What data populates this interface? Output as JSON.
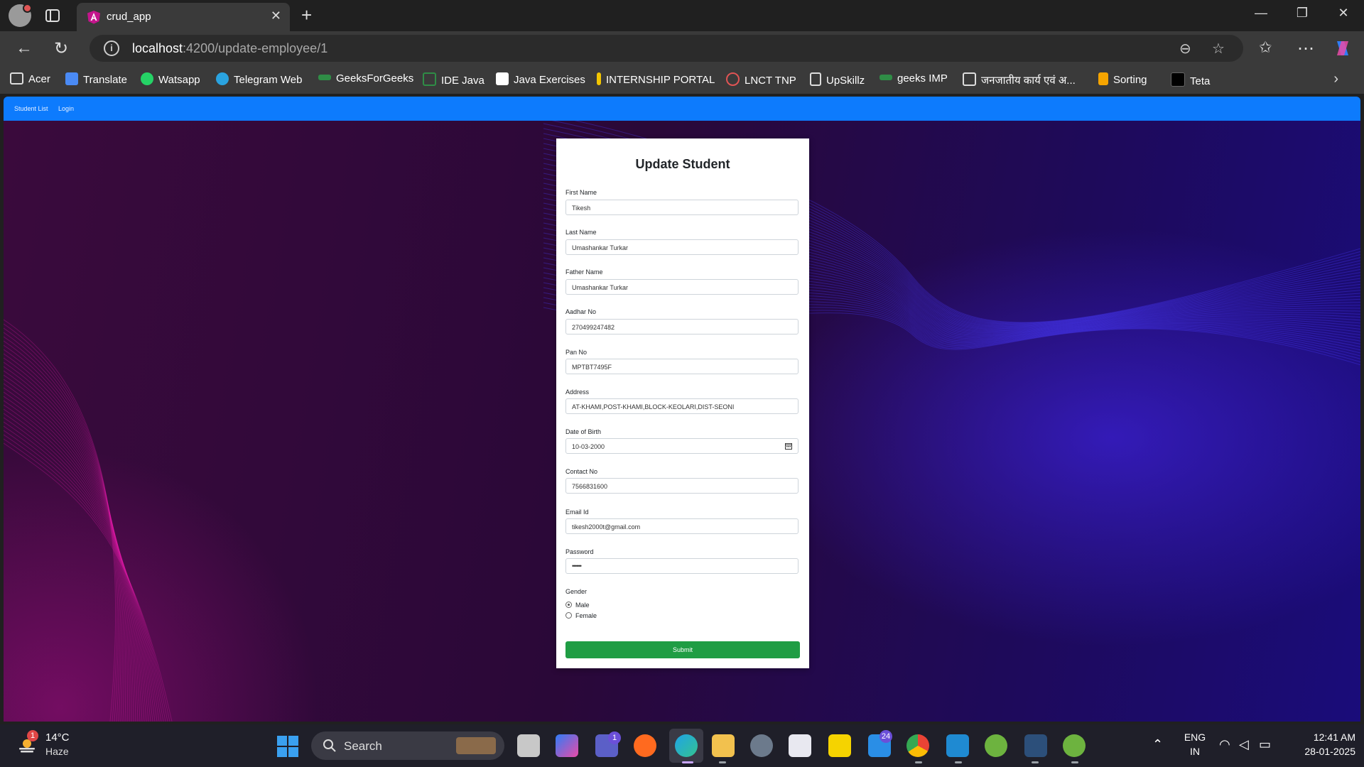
{
  "browser": {
    "tab_title": "crud_app",
    "url_host": "localhost",
    "url_path": ":4200/update-employee/1",
    "icons": [
      "profile-icon",
      "tab-actions-icon",
      "close-icon",
      "new-tab-icon",
      "minimize-icon",
      "maximize-icon",
      "close-window-icon",
      "back-icon",
      "refresh-icon",
      "info-icon",
      "zoom-icon",
      "favorite-icon",
      "favorites-icon",
      "more-icon",
      "copilot-icon"
    ]
  },
  "bookmarks": [
    "Acer",
    "Translate",
    "Watsapp",
    "Telegram Web",
    "GeeksForGeeks",
    "IDE Java",
    "Java Exercises",
    "INTERNSHIP PORTAL",
    "LNCT TNP",
    "UpSkillz",
    "geeks IMP",
    "जनजातीय कार्य एवं अ...",
    "Sorting",
    "Teta"
  ],
  "app": {
    "nav_student_list": "Student List",
    "nav_login": "Login",
    "form_title": "Update Student",
    "fields": {
      "first_name": {
        "label": "First Name",
        "value": "Tikesh"
      },
      "last_name": {
        "label": "Last Name",
        "value": "Umashankar Turkar"
      },
      "father_name": {
        "label": "Father Name",
        "value": "Umashankar Turkar"
      },
      "aadhar": {
        "label": "Aadhar No",
        "value": "270499247482"
      },
      "pan": {
        "label": "Pan No",
        "value": "MPTBT7495F"
      },
      "address": {
        "label": "Address",
        "value": "AT-KHAMI,POST-KHAMI,BLOCK-KEOLARI,DIST-SEONI"
      },
      "dob": {
        "label": "Date of Birth",
        "value": "10-03-2000"
      },
      "contact": {
        "label": "Contact No",
        "value": "7566831600"
      },
      "email": {
        "label": "Email Id",
        "value": "tikesh2000t@gmail.com"
      },
      "password": {
        "label": "Password",
        "value": "••••••"
      }
    },
    "gender_label": "Gender",
    "gender_options": [
      "Male",
      "Female"
    ],
    "gender_selected": "Male",
    "submit_label": "Submit"
  },
  "taskbar": {
    "weather_badge": "1",
    "temperature": "14°C",
    "weather": "Haze",
    "search_label": "Search",
    "teams_badge": "1",
    "mail_badge": "24",
    "lang_top": "ENG",
    "lang_bottom": "IN",
    "time": "12:41 AM",
    "date": "28-01-2025"
  },
  "colors": {
    "app_nav": "#0d7bfd",
    "submit": "#1f9d44",
    "wave_blue": "#4a3cff",
    "wave_pink": "#e21aa8"
  }
}
